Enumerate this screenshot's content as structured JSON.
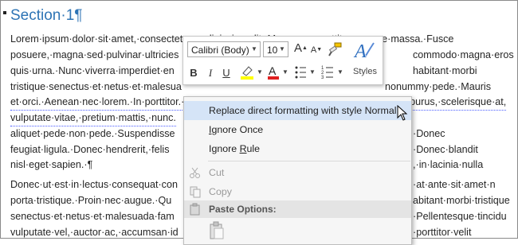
{
  "document": {
    "heading": "Section·1¶",
    "paragraph1": [
      "Lorem·ipsum·dolor·sit·amet,·consectetuer·adipiscing·elit.·Maecenas·porttitor·congue·massa.·Fusce",
      "posuere,·magna·sed·pulvinar·ultricies",
      "quis·urna.·Nunc·viverra·imperdiet·en",
      "tristique·senectus·et·netus·et·malesua",
      "et·orci.·Aenean·nec·lorem.·In·porttitor.·Donec·laoreet·nonummy·augue.·Suspendisse·dui·purus,·scelerisque·at,",
      "vulputate·vitae,·pretium·mattis,·nunc.",
      "aliquet·pede·non·pede.·Suspendisse",
      "feugiat·ligula.·Donec·hendrerit,·felis",
      "nisl·eget·sapien.·¶"
    ],
    "paragraph1_right": [
      "",
      "commodo·magna·eros",
      "habitant·morbi",
      "nonummy·pede.·Mauris",
      "",
      "",
      "·Donec",
      "·Donec·blandit",
      ",·in·lacinia·nulla"
    ],
    "paragraph2": [
      "Donec·ut·est·in·lectus·consequat·con",
      "porta·tristique.·Proin·nec·augue.·Qu",
      "senectus·et·netus·et·malesuada·fam",
      "vulputate·vel,·auctor·ac,·accumsan·id"
    ],
    "paragraph2_right": [
      "·at·ante·sit·amet·n",
      "abitant·morbi·tristique",
      "·Pellentesque·tincidu",
      "·porttitor·velit"
    ]
  },
  "mini_toolbar": {
    "font_name": "Calibri (Body)",
    "font_size": "10",
    "styles_label": "Styles",
    "bold": "B",
    "italic": "I",
    "underline": "U",
    "grow_font": "A",
    "shrink_font": "A",
    "font_color_letter": "A",
    "highlight_color": "#ffff00",
    "font_color": "#e02020"
  },
  "context_menu": {
    "items": [
      {
        "label": "Replace direct formatting with style Normal",
        "highlighted": true
      },
      {
        "label": "Ignore Once"
      },
      {
        "label": "Ignore Rule"
      },
      {
        "label": "Cut",
        "disabled": true
      },
      {
        "label": "Copy",
        "disabled": true
      }
    ],
    "paste_header": "Paste Options:"
  }
}
